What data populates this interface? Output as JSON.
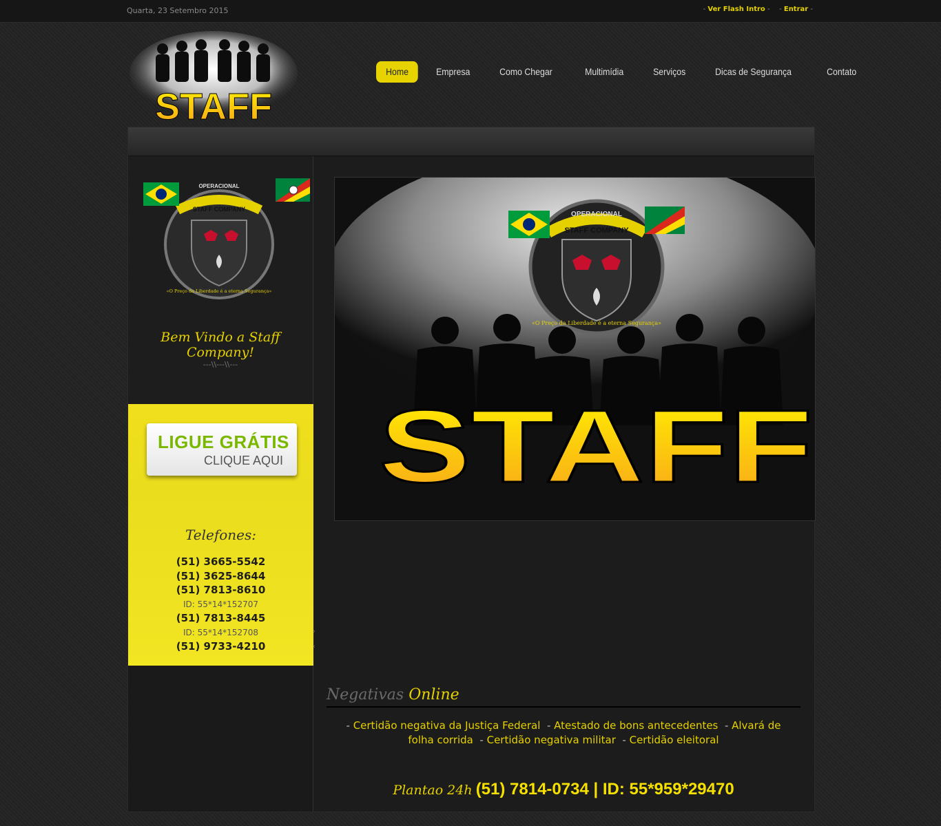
{
  "topbar": {
    "date": "Quarta, 23 Setembro 2015",
    "links": [
      "Ver Flash Intro",
      "Entrar"
    ]
  },
  "logo": {
    "text": "STAFF"
  },
  "nav": {
    "items": [
      "Home",
      "Empresa",
      "Como Chegar",
      "Multimídia",
      "Serviços",
      "Dicas de Segurança",
      "Contato"
    ],
    "active": "Home"
  },
  "sidebar": {
    "badge": {
      "top_text": "OPERACIONAL",
      "company": "STAFF COMPANY",
      "motto": "«O Preço da Liberdade é a eterna Segurança»"
    },
    "welcome": "Bem Vindo a Staff Company!",
    "separator": "---\\\\---\\\\---",
    "ligue": {
      "line1": "LIGUE GRÁTIS",
      "line2": "CLIQUE AQUI"
    },
    "telefones_title": "Telefones:",
    "phones": [
      {
        "text": "(51) 3665-5542",
        "kind": "num"
      },
      {
        "text": "(51) 3625-8644",
        "kind": "num"
      },
      {
        "text": "(51) 7813-8610",
        "kind": "num"
      },
      {
        "text": "ID: 55*14*152707",
        "kind": "id"
      },
      {
        "text": "(51) 7813-8445",
        "kind": "num"
      },
      {
        "text": "ID: 55*14*152708",
        "kind": "id"
      },
      {
        "text": "(51) 9733-4210",
        "kind": "num"
      }
    ]
  },
  "banner": {
    "top_text": "OPERACIONAL",
    "company": "STAFF COMPANY",
    "motto": "«O Preço da Liberdade é a eterna Segurança»",
    "big_text": "STAFF"
  },
  "negativas": {
    "title_part1": "Negativas",
    "title_part2": "Online",
    "items": [
      "Certidão negativa da Justiça Federal",
      "Atestado de bons antecedentes",
      "Alvará de folha corrida",
      "Certidão negativa militar",
      "Certidão eleitoral"
    ]
  },
  "plantao": {
    "label": "Plantao 24h",
    "value": "(51) 7814-0734 | ID: 55*959*29470"
  },
  "colors": {
    "accent": "#e6d100",
    "background": "#232323",
    "yellow_panel": "#f0df1c",
    "ligue_green": "#7ab800"
  }
}
